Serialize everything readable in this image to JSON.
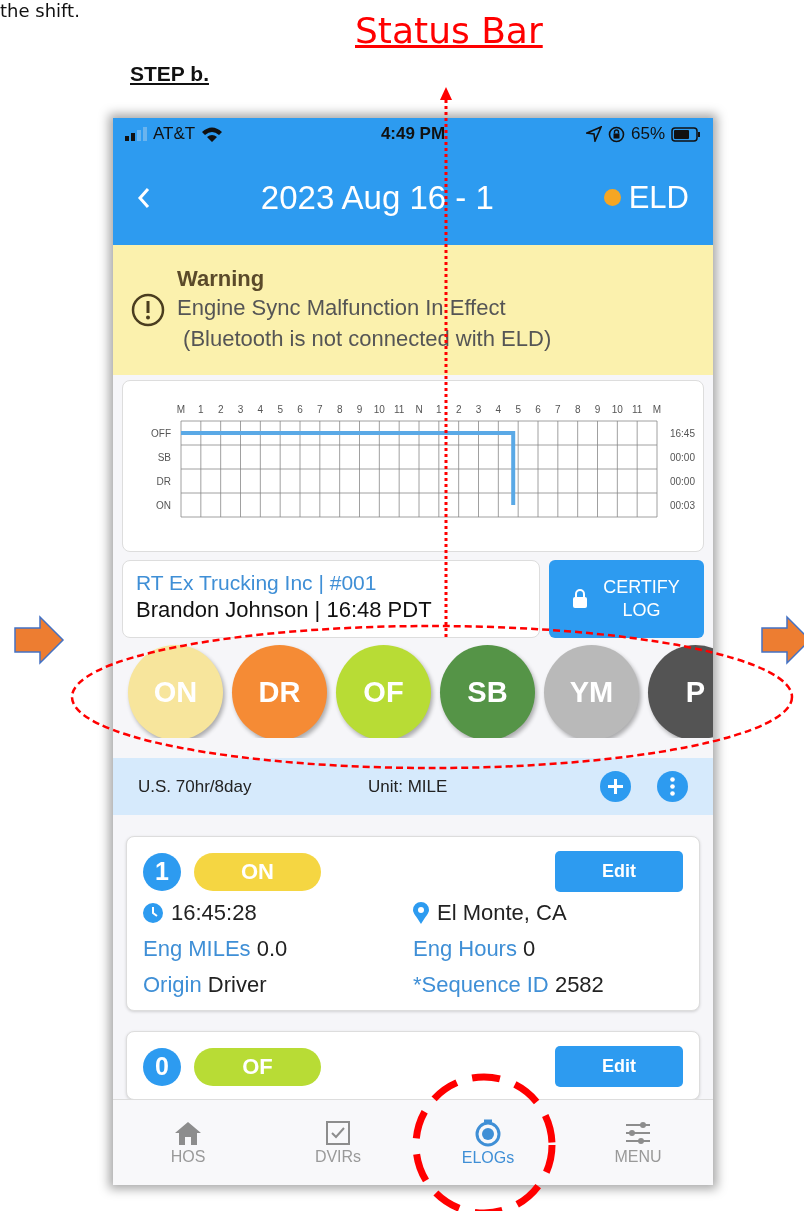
{
  "document": {
    "top_text": "the shift.",
    "callout": "Status Bar",
    "step_label": "STEP b."
  },
  "status_bar": {
    "carrier": "AT&T",
    "time": "4:49 PM",
    "battery": "65%"
  },
  "header": {
    "title": "2023 Aug 16 - 1",
    "eld_label": "ELD"
  },
  "warning": {
    "title": "Warning",
    "lines": [
      "Engine Sync Malfunction In Effect",
      " (Bluetooth is not connected with ELD)"
    ]
  },
  "log_grid": {
    "hour_labels": [
      "M",
      "1",
      "2",
      "3",
      "4",
      "5",
      "6",
      "7",
      "8",
      "9",
      "10",
      "11",
      "N",
      "1",
      "2",
      "3",
      "4",
      "5",
      "6",
      "7",
      "8",
      "9",
      "10",
      "11",
      "M"
    ],
    "status_labels": [
      "OFF",
      "SB",
      "DR",
      "ON"
    ],
    "totals": [
      "16:45",
      "00:00",
      "00:00",
      "00:03"
    ]
  },
  "driver_info": {
    "company": "RT Ex Trucking Inc | #001",
    "driver": "Brandon Johnson | 16:48 PDT"
  },
  "certify_button": "CERTIFY LOG",
  "status_buttons": [
    {
      "label": "ON",
      "color": "#f7e59c"
    },
    {
      "label": "DR",
      "color": "#f58b35"
    },
    {
      "label": "OF",
      "color": "#b8dc35"
    },
    {
      "label": "SB",
      "color": "#559447"
    },
    {
      "label": "YM",
      "color": "#b9b9b9"
    },
    {
      "label": "P",
      "color": "#545454"
    }
  ],
  "rule_bar": {
    "cycle": "U.S. 70hr/8day",
    "unit": "Unit: MILE"
  },
  "events": [
    {
      "number": "1",
      "status": "ON",
      "color": "#f5d642",
      "edit": "Edit",
      "time": "16:45:28",
      "location": "El Monte, CA",
      "fields": [
        {
          "label": "Eng MILEs",
          "value": "0.0"
        },
        {
          "label": "Eng Hours",
          "value": "0"
        },
        {
          "label": "Origin",
          "value": "Driver"
        },
        {
          "label": "*Sequence ID",
          "value": "2582"
        }
      ]
    },
    {
      "number": "0",
      "status": "OF",
      "color": "#b8dc35",
      "edit": "Edit"
    }
  ],
  "tabs": [
    {
      "label": "HOS",
      "selected": false
    },
    {
      "label": "DVIRs",
      "selected": false
    },
    {
      "label": "ELOGs",
      "selected": true
    },
    {
      "label": "MENU",
      "selected": false
    }
  ]
}
